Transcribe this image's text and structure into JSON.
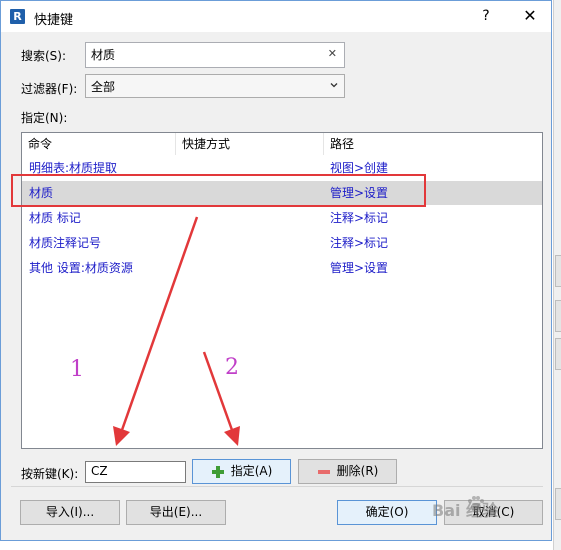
{
  "window": {
    "title": "快捷键",
    "help_label": "?",
    "close_label": "✕",
    "logo_letter": "R"
  },
  "search": {
    "label": "搜索(S):",
    "value": "材质"
  },
  "filter": {
    "label": "过滤器(F):",
    "value": "全部"
  },
  "assign_label": "指定(N):",
  "table": {
    "columns": [
      "命令",
      "快捷方式",
      "路径"
    ],
    "rows": [
      {
        "command": "明细表:材质提取",
        "shortcut": "",
        "path": "视图>创建",
        "selected": false
      },
      {
        "command": "材质",
        "shortcut": "",
        "path": "管理>设置",
        "selected": true
      },
      {
        "command": "材质 标记",
        "shortcut": "",
        "path": "注释>标记",
        "selected": false
      },
      {
        "command": "材质注释记号",
        "shortcut": "",
        "path": "注释>标记",
        "selected": false
      },
      {
        "command": "其他 设置:材质资源",
        "shortcut": "",
        "path": "管理>设置",
        "selected": false
      }
    ]
  },
  "new_key": {
    "label": "按新键(K):",
    "value": "CZ"
  },
  "buttons": {
    "assign": "指定(A)",
    "delete": "删除(R)",
    "import": "导入(I)...",
    "export": "导出(E)...",
    "ok": "确定(O)",
    "cancel": "取消(C)"
  },
  "annotations": {
    "step1": "1",
    "step2": "2"
  },
  "watermark": "Bai 经验",
  "colors": {
    "highlight_box": "#e2383a",
    "arrow": "#e2383a",
    "step_numbers": "#c03fc8",
    "link_text": "#1c1cc8"
  }
}
